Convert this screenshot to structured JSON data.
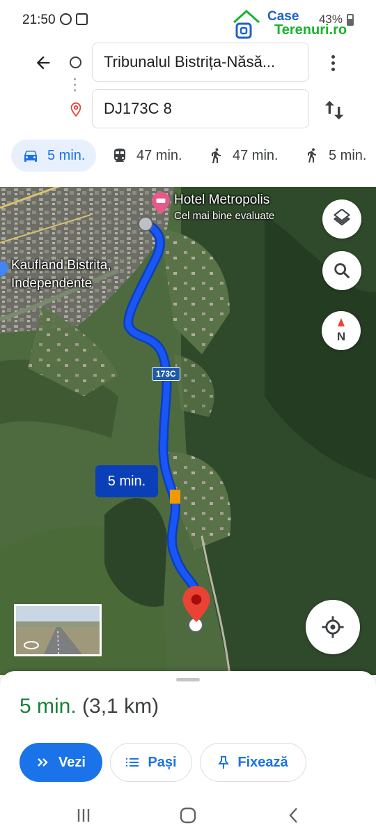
{
  "status_bar": {
    "time": "21:50",
    "battery": "43%",
    "watermark_line1": "Case",
    "watermark_line2": "Terenuri.ro"
  },
  "route": {
    "origin": "Tribunalul Bistrița-Năsă...",
    "destination": "DJ173C 8"
  },
  "modes": [
    {
      "label": "5 min.",
      "icon": "car-icon",
      "active": true
    },
    {
      "label": "47 min.",
      "icon": "transit-icon",
      "active": false
    },
    {
      "label": "47 min.",
      "icon": "walk-icon",
      "active": false
    },
    {
      "label": "5 min.",
      "icon": "ride-icon",
      "active": false
    }
  ],
  "map": {
    "poi_name": "Hotel Metropolis",
    "poi_sub": "Cel mai bine evaluate",
    "poi2_line1": "Kaufland Bistrita,",
    "poi2_line2": "Independente",
    "road_shield": "173C",
    "route_time": "5 min.",
    "route_color": "#1a56f5",
    "north_label": "N"
  },
  "sheet": {
    "duration": "5 min.",
    "distance": "(3,1 km)",
    "btn_go": "Vezi",
    "btn_steps": "Pași",
    "btn_pin": "Fixează"
  },
  "colors": {
    "accent": "#1a73e8",
    "duration_green": "#188038",
    "destination_pin": "#ea4335"
  }
}
